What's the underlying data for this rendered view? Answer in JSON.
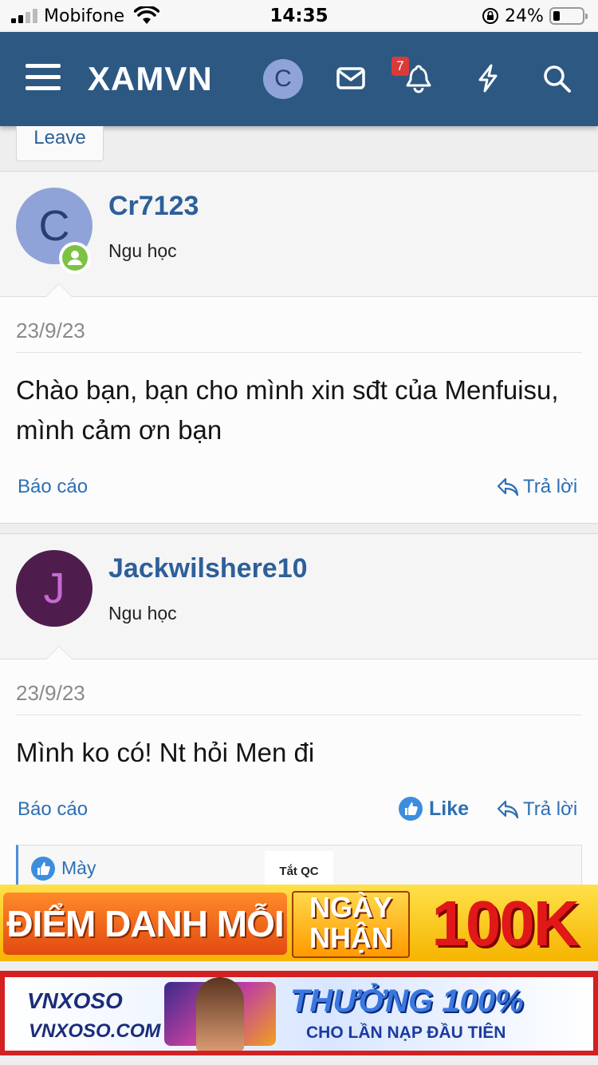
{
  "status_bar": {
    "carrier": "Mobifone",
    "time": "14:35",
    "battery": "24%"
  },
  "header": {
    "logo": "XAMVN",
    "avatar_letter": "C",
    "notification_count": "7"
  },
  "leave_button": "Leave",
  "messages": [
    {
      "avatar_letter": "C",
      "avatar_bg": "#8fa3d8",
      "avatar_fg": "#28406f",
      "username": "Cr7123",
      "user_title": "Ngu học",
      "date": "23/9/23",
      "body": "Chào bạn, bạn cho mình xin sđt của Menfuisu, mình cảm ơn bạn",
      "report": "Báo cáo",
      "reply": "Trả lời"
    },
    {
      "avatar_letter": "J",
      "avatar_bg": "#4e1d4e",
      "avatar_fg": "#c66ad0",
      "username": "Jackwilshere10",
      "user_title": "Ngu học",
      "date": "23/9/23",
      "body": "Mình ko có! Nt hỏi Men đi",
      "report": "Báo cáo",
      "like": "Like",
      "reply": "Trả lời"
    }
  ],
  "reactions": {
    "name": "Mày"
  },
  "ad_close": "Tắt QC",
  "ads": {
    "banner1_left": "ĐIỂM DANH MỖI",
    "banner1_mid_top": "NGÀY",
    "banner1_mid_bottom": "NHẬN",
    "banner1_right": "100K",
    "banner2_logo": "VNXOSO",
    "banner2_site": "VNXOSO.COM",
    "banner2_head": "THƯỞNG 100%",
    "banner2_sub": "CHO LẦN NẠP ĐẦU TIÊN"
  },
  "colors": {
    "header": "#2d5882",
    "link": "#2d6fb4",
    "username": "#2d5f9a",
    "online": "#7cc243"
  }
}
